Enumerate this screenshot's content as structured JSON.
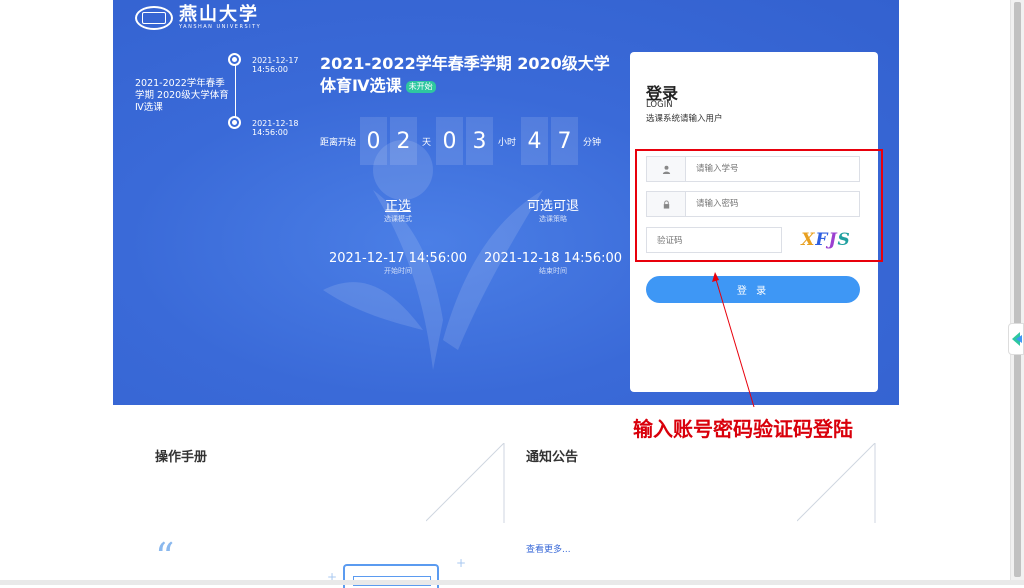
{
  "logo": {
    "name_cn": "燕山大学",
    "name_en": "YANSHAN UNIVERSITY"
  },
  "timeline": {
    "start_date": "2021-12-17",
    "start_time": "14:56:00",
    "end_date": "2021-12-18",
    "end_time": "14:56:00",
    "course_name": "2021-2022学年春季学期 2020级大学体育Ⅳ选课"
  },
  "course": {
    "title": "2021-2022学年春季学期 2020级大学体育Ⅳ选课",
    "status_badge": "未开始"
  },
  "countdown": {
    "label": "距离开始",
    "days": [
      "0",
      "2"
    ],
    "days_unit": "天",
    "hours": [
      "0",
      "3"
    ],
    "hours_unit": "小时",
    "minutes": [
      "4",
      "7"
    ],
    "minutes_unit": "分钟"
  },
  "selection": {
    "mode_value": "正选",
    "mode_label": "选课模式",
    "strategy_value": "可选可退",
    "strategy_label": "选课策略",
    "start_value": "2021-12-17 14:56:00",
    "start_label": "开始时间",
    "end_value": "2021-12-18 14:56:00",
    "end_label": "结束时间"
  },
  "login": {
    "title": "登录",
    "title_en": "LOGIN",
    "description": "选课系统请输入用户",
    "username_placeholder": "请输入学号",
    "password_placeholder": "请输入密码",
    "captcha_placeholder": "验证码",
    "captcha_text": "XFJS",
    "button_label": "登 录"
  },
  "annotation": {
    "text": "输入账号密码验证码登陆",
    "color": "#d9000b"
  },
  "sections": {
    "manual_title": "操作手册",
    "notice_title": "通知公告",
    "more_link": "查看更多..."
  },
  "colors": {
    "hero": "#3a6ad8",
    "login_button": "#3e97f5",
    "badge": "#2ec7a0",
    "annotation": "#e8000c"
  },
  "icons": {
    "username": "user-icon",
    "password": "lock-icon",
    "quote": "quote-icon"
  }
}
